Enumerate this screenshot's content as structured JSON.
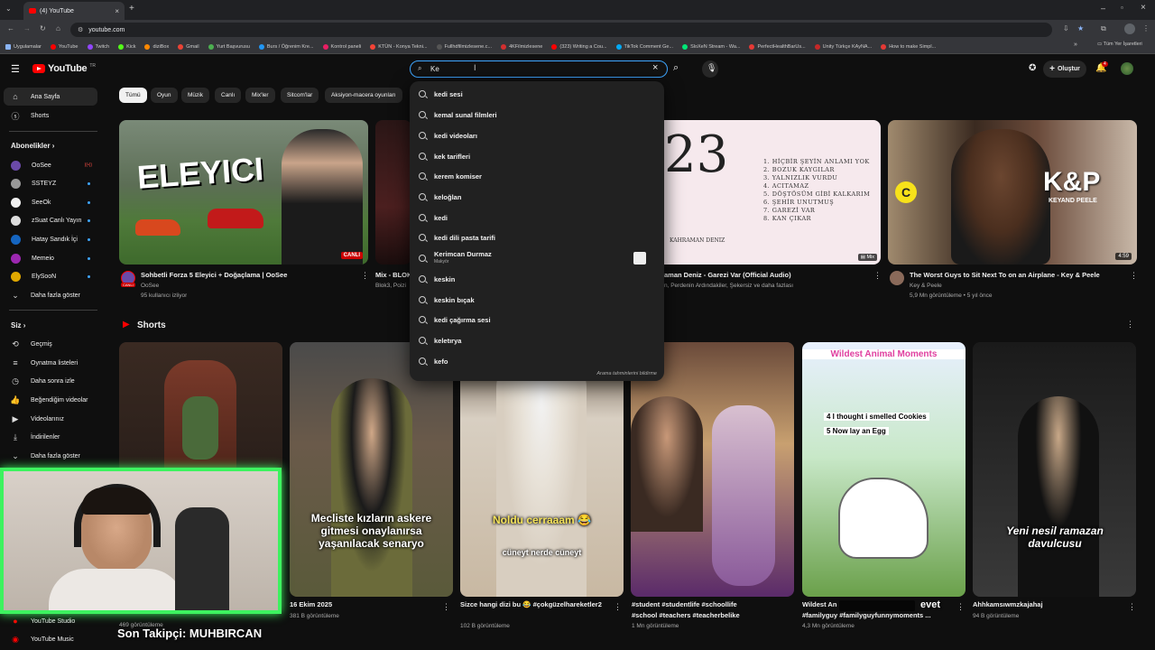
{
  "browser": {
    "tab_title": "(4) YouTube",
    "url": "youtube.com",
    "bookmarks": [
      "Uygulamalar",
      "YouTube",
      "Twitch",
      "Kick",
      "diziBox",
      "Gmail",
      "Yurt Başvurusu",
      "Burs / Öğrenim Kre...",
      "Kontrol paneli",
      "KTÜN - Konya Tekni...",
      "Fullhdfilmizlesene.c...",
      "4KFilmizlesene",
      "(323) Writing a Cou...",
      "TikTok Comment Ge...",
      "SloXeN Stream - Wa...",
      "PerfectHealthBarUs...",
      "Unity Türkçe KAyNA...",
      "How to make Simpl..."
    ],
    "all_bookmarks": "Tüm Yer İşaretleri"
  },
  "header": {
    "logo_text": "YouTube",
    "logo_country": "TR",
    "search_value": "Ke",
    "create_label": "Oluştur",
    "notif_count": "4"
  },
  "sidebar": {
    "home": "Ana Sayfa",
    "shorts": "Shorts",
    "subs_title": "Abonelikler",
    "subs": [
      "OoSee",
      "SSTEYZ",
      "SeeOk",
      "zSuat Canlı Yayın",
      "Hatay Sandık İçi",
      "Memeio",
      "ElySooN"
    ],
    "more": "Daha fazla göster",
    "you_title": "Siz",
    "you_items": [
      "Geçmiş",
      "Oynatma listeleri",
      "Daha sonra izle",
      "Beğendiğim videolar",
      "Videolarınız",
      "İndirilenler",
      "Daha fazla göster"
    ],
    "bottom_items": [
      "YouTube Studio",
      "YouTube Music"
    ]
  },
  "chips": [
    "Tümü",
    "Oyun",
    "Müzik",
    "Canlı",
    "Mix'ler",
    "Sitcom'lar",
    "Aksiyon-macera oyunları"
  ],
  "videos": [
    {
      "thumb_text": "ELEYICI",
      "badge": "CANLI",
      "title": "Sohbetli Forza 5 Eleyici + Doğaçlama | OoSee",
      "channel": "OoSee",
      "meta": "95 kullanıcı izliyor",
      "avatar_badge": "CANLI"
    },
    {
      "title": "Mix - BLOK",
      "meta": "Blok3, Poizi"
    },
    {
      "title": "aman Deniz - Garezi Var (Official Audio)",
      "meta": "n, Perdenin Ardındakiler, Şekersiz ve daha fazlası",
      "badge": "Mix",
      "thumb_lines": [
        "1. HİÇBİR ŞEYİN ANLAMI YOK",
        "2. BOZUK KAYGILAR",
        "3. YALNIZLIK VURDU",
        "4. ACITAMAZ",
        "5. DÖŞTÖSÜM GİBİ KALKARIM",
        "6. ŞEHİR UNUTMUŞ",
        "7. GAREZİ VAR",
        "8. KAN ÇIKAR"
      ],
      "thumb_number": "23",
      "thumb_artist": "KAHRAMAN DENIZ"
    },
    {
      "title": "The Worst Guys to Sit Next To on an Airplane - Key & Peele",
      "channel": "Key & Peele",
      "meta": "5,9 Mn görüntüleme • 5 yıl önce",
      "duration": "4:59",
      "logo": "K&P",
      "logo_sub": "KEYAND PEELE"
    }
  ],
  "suggestions": [
    "kedi sesi",
    "kemal sunal filmleri",
    "kedi videoları",
    "kek tarifleri",
    "kerem komiser",
    "keloğlan",
    "kedi",
    "kedi dili pasta tarifi",
    "Kerimcan Durmaz",
    "keskin",
    "keskin bıçak",
    "kedi çağırma sesi",
    "keletırya",
    "kefo"
  ],
  "suggestion_sub": "Makyör",
  "suggestion_footer": "Arama tahminlerini bildirme",
  "shorts_section": {
    "title": "Shorts",
    "items": [
      {
        "title": "16 Ekim 2025",
        "views": "381 B görüntüleme"
      },
      {
        "title": "Sizce hangi dizi bu 😂 #çokgüzelhareketler2",
        "views": "102 B görüntüleme",
        "caption": "Mecliste kızların askere gitmesi onaylanırsa yaşanılacak senaryo"
      },
      {
        "title": "#student #studentlife #schoollife",
        "title2": "#school #teachers #teacherbelike",
        "views": "1 Mn görüntüleme",
        "caption": "Noldu cerraaam 😂",
        "caption2": "cüneyt nerde cüneyt"
      },
      {
        "title": "Wildest An",
        "title2": "#familyguy #familyguyfunnymoments ...",
        "views": "4,3 Mn görüntüleme"
      },
      {
        "title": "Ahhkamsıwmzkajahaj",
        "views": "94 B görüntüleme",
        "caption": "Wildest Animal Moments",
        "caption_lines": [
          "4  I thought i smelled Cookies",
          "5  Now lay an Egg"
        ]
      },
      {
        "caption": "Yeni nesil ramazan davulcusu"
      }
    ]
  },
  "stream_overlay": {
    "last_follower": "Son Takipçi: MUHBIRCAN",
    "ticker": "evet",
    "extra_views": "469 görüntüleme"
  },
  "colors": {
    "accent": "#3ea6ff",
    "brand": "#ff0000",
    "bg": "#0f0f0f",
    "overlay_green": "#3df25f"
  }
}
